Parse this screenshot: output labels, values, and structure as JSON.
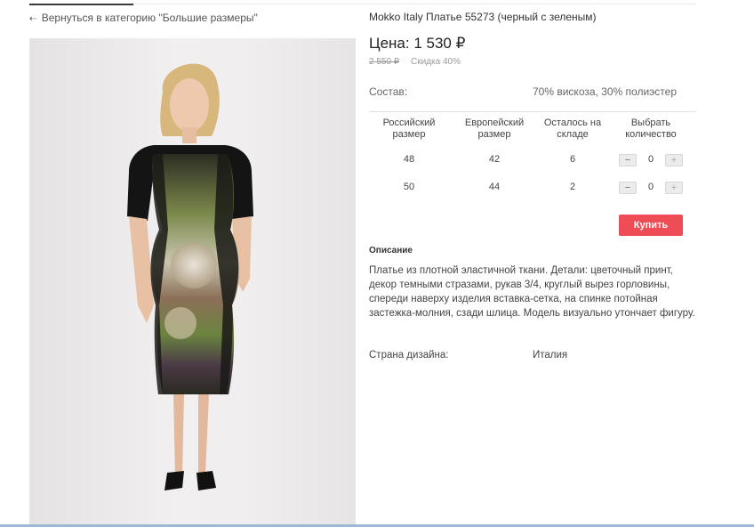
{
  "nav": {
    "back_label": "Вернуться в категорию \"Большие размеры\""
  },
  "product": {
    "title": "Mokko Italy Платье 55273 (черный с зеленым)",
    "price": "Цена: 1 530 ₽",
    "old_price": "2 550 ₽",
    "discount": "Скидка 40%",
    "composition_label": "Состав:",
    "composition_value": "70% вискоза, 30% полиэстер",
    "buy_label": "Купить",
    "description_heading": "Описание",
    "description": "Платье из плотной эластичной ткани. Детали: цветочный принт, декор темными стразами, рукав 3/4, круглый вырез горловины, спереди наверху изделия вставка-сетка, на спинке потойная застежка-молния, сзади шлица. Модель визуально утончает фигуру.",
    "country_label": "Страна дизайна:",
    "country_value": "Италия"
  },
  "size_table": {
    "headers": {
      "ru": "Российский размер",
      "eu": "Европейский размер",
      "stock": "Осталось на складе",
      "qty": "Выбрать количество"
    },
    "rows": [
      {
        "ru": "48",
        "eu": "42",
        "stock": "6",
        "qty": "0",
        "minus": "−",
        "plus": "+"
      },
      {
        "ru": "50",
        "eu": "44",
        "stock": "2",
        "qty": "0",
        "minus": "−",
        "plus": "+"
      }
    ]
  },
  "icons": {
    "back": "arrow-left-icon"
  },
  "colors": {
    "accent": "#ef4d55",
    "text": "#333333",
    "muted": "#999999"
  }
}
